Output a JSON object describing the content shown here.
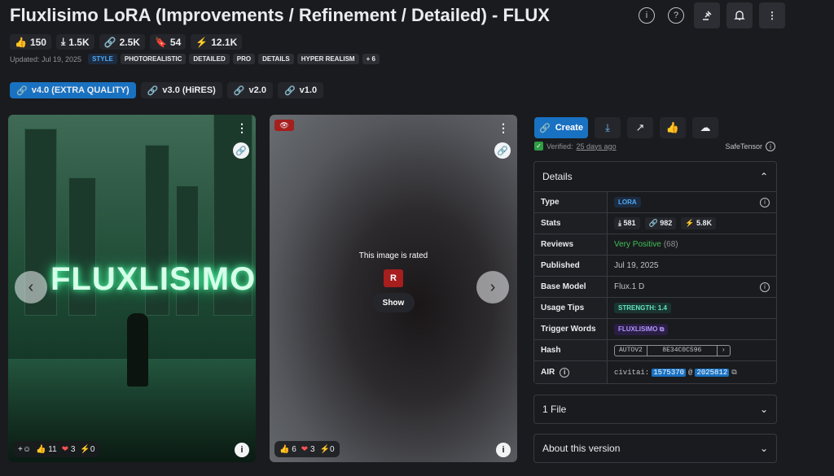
{
  "header": {
    "title": "Fluxlisimo LoRA (Improvements / Refinement / Detailed) - FLUX",
    "icons": [
      "info-icon",
      "help-icon",
      "gavel-icon",
      "bell-plus-icon",
      "more-vertical-icon"
    ]
  },
  "stats": {
    "likes": "150",
    "downloads": "1.5K",
    "generations": "2.5K",
    "bookmarks": "54",
    "buzz": "12.1K"
  },
  "meta": {
    "updated": "Updated: Jul 19, 2025",
    "tags": [
      "STYLE",
      "PHOTOREALISTIC",
      "DETAILED",
      "PRO",
      "DETAILS",
      "HYPER REALISM",
      "+ 6"
    ]
  },
  "versions": [
    "v4.0 (EXTRA QUALITY)",
    "v3.0 (HiRES)",
    "v2.0",
    "v1.0"
  ],
  "gallery": {
    "card1": {
      "neon_text": "FLUXLISIMO",
      "likes": "11",
      "hearts": "3",
      "buzz": "0"
    },
    "card2": {
      "rated_text": "This image is rated",
      "rating_badge": "R",
      "show_label": "Show",
      "likes": "6",
      "hearts": "3",
      "buzz": "0"
    }
  },
  "actions": {
    "create_label": "Create",
    "verified_prefix": "Verified:",
    "verified_time": "25 days ago",
    "safetensor": "SafeTensor"
  },
  "details": {
    "heading": "Details",
    "type_label": "Type",
    "type_value": "LORA",
    "stats_label": "Stats",
    "stats_downloads": "581",
    "stats_generations": "982",
    "stats_buzz": "5.8K",
    "reviews_label": "Reviews",
    "reviews_value": "Very Positive",
    "reviews_count": "(68)",
    "published_label": "Published",
    "published_value": "Jul 19, 2025",
    "base_model_label": "Base Model",
    "base_model_value": "Flux.1 D",
    "usage_tips_label": "Usage Tips",
    "usage_tips_value": "STRENGTH: 1.4",
    "trigger_label": "Trigger Words",
    "trigger_value": "FLUXLISIMO",
    "hash_label": "Hash",
    "hash_type": "AUTOV2",
    "hash_value": "8E34C0C596",
    "air_label": "AIR",
    "air_prefix": "civitai:",
    "air_model": "1575370",
    "air_at": "@",
    "air_version": "2025812"
  },
  "accordions": {
    "files": "1 File",
    "about": "About this version"
  },
  "colors": {
    "accent": "#1971c2",
    "background": "#1a1b1e",
    "positive": "#40c057",
    "rated": "#a61e1e"
  }
}
